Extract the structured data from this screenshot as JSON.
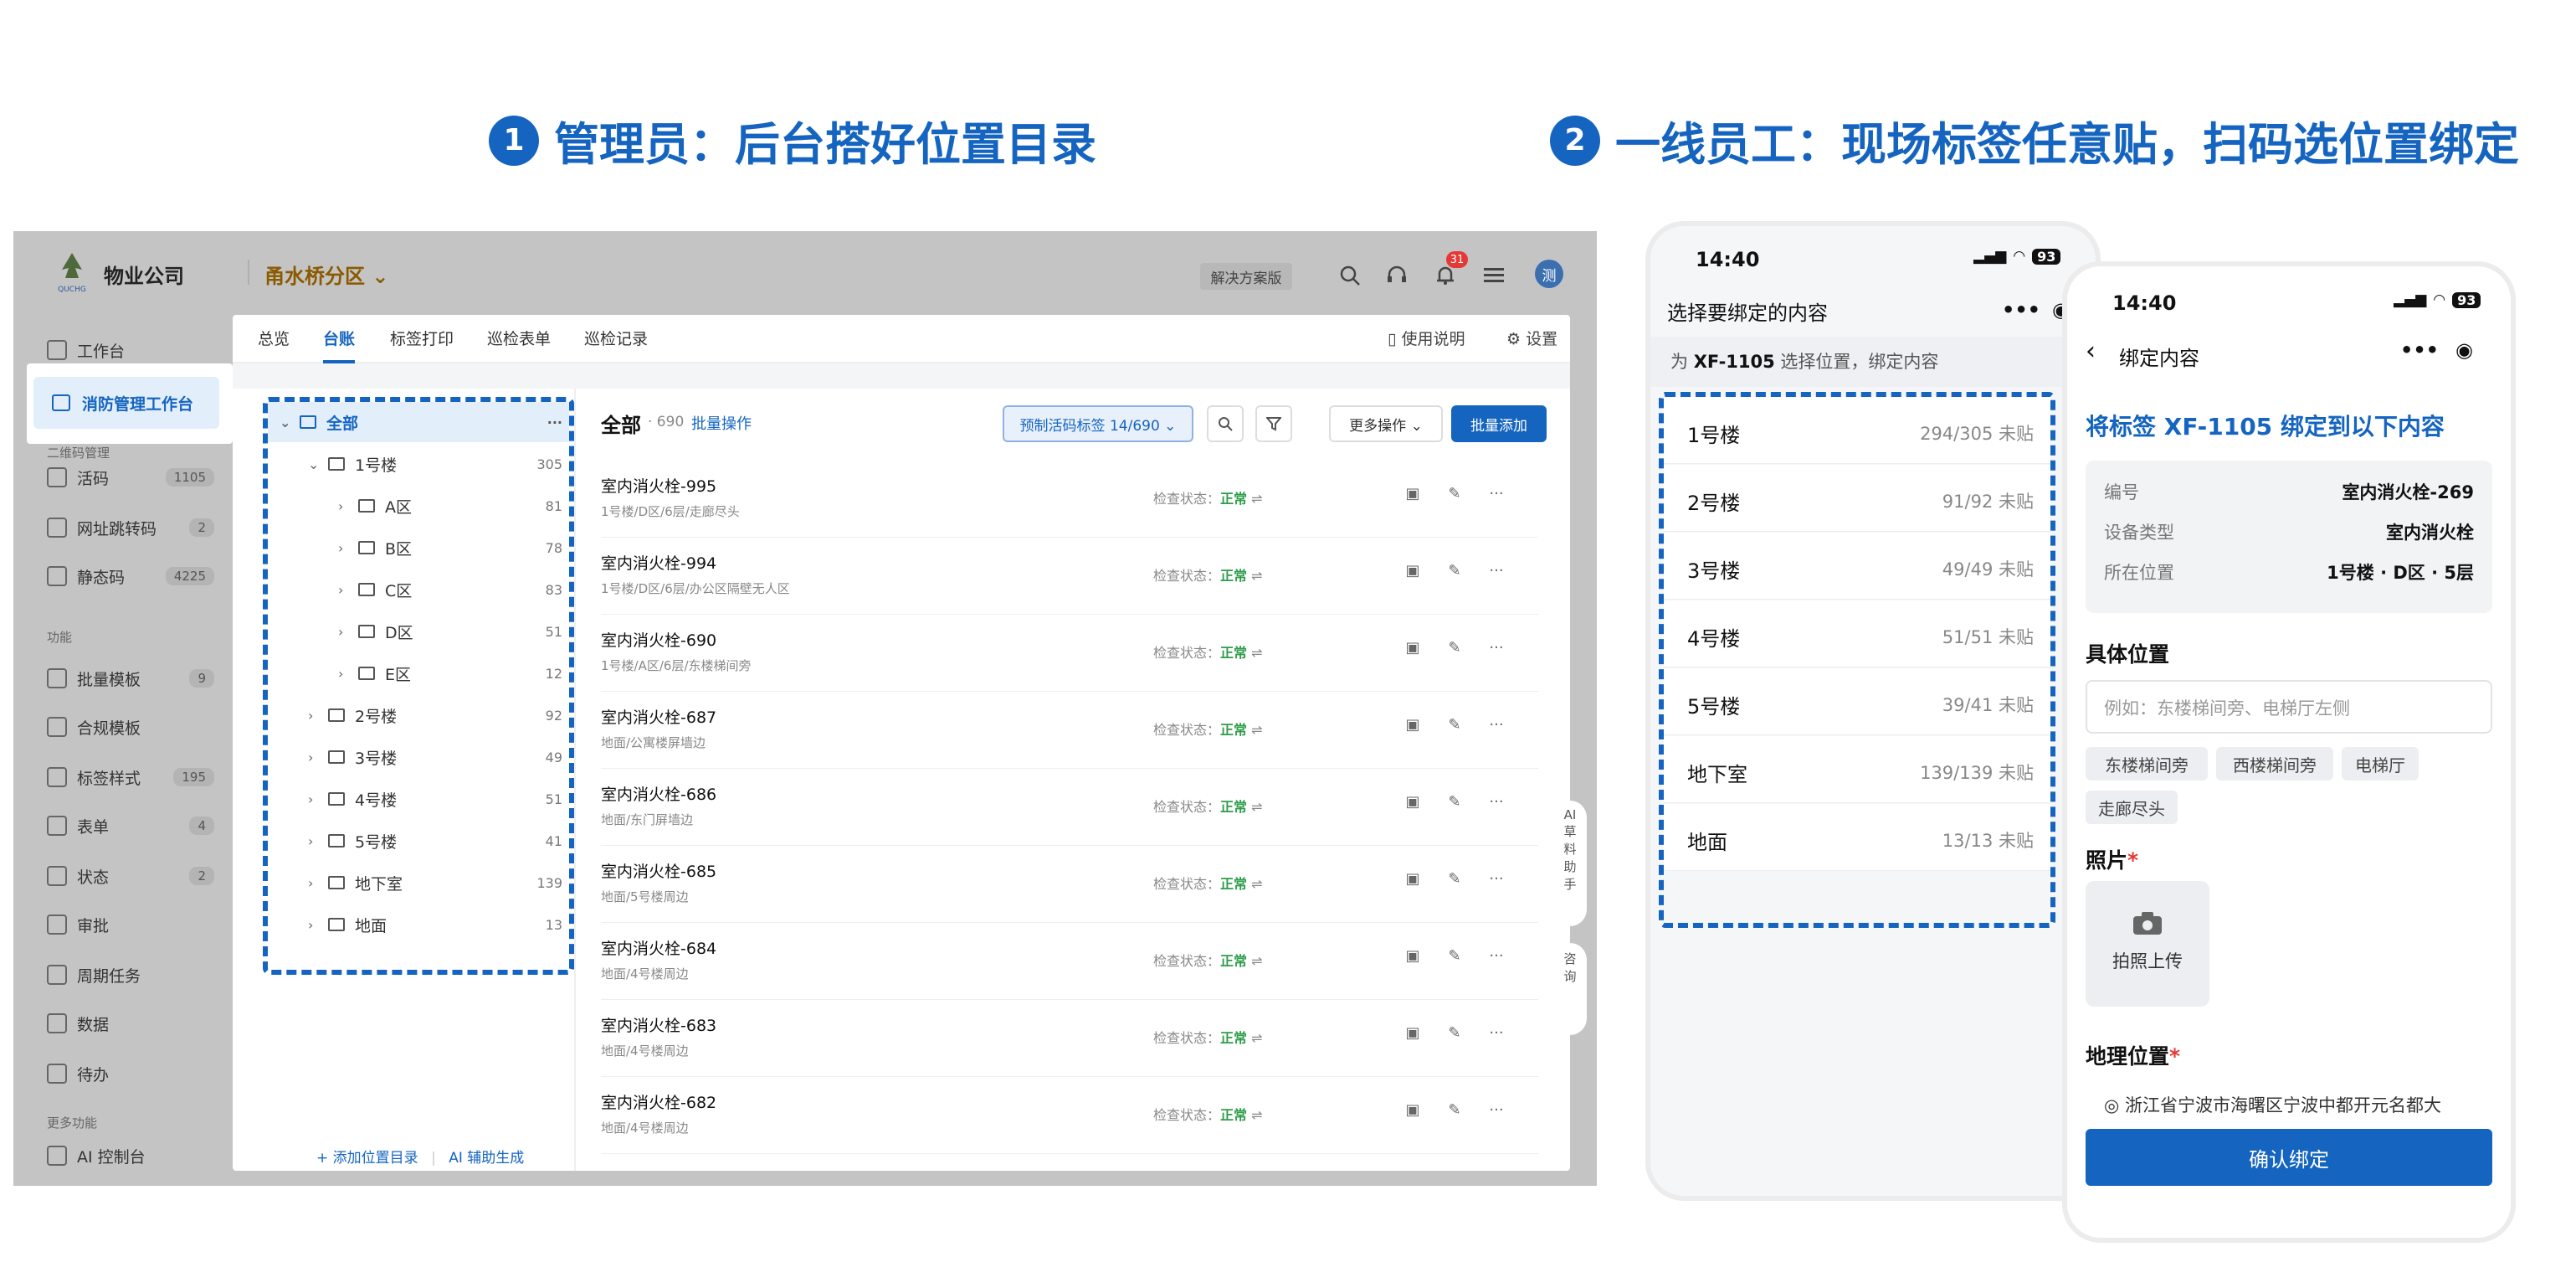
{
  "headings": {
    "step1_num": "1",
    "step1": "管理员：后台搭好位置目录",
    "step2_num": "2",
    "step2": "一线员工：现场标签任意贴，扫码选位置绑定"
  },
  "admin": {
    "org_name": "物业公司",
    "logo_text": "QUCHG",
    "area": "甬水桥分区 ⌄",
    "solution_btn": "解决方案版",
    "notify_badge": "31",
    "avatar": "测",
    "sidebar": {
      "items": [
        {
          "label": "工作台",
          "count": ""
        },
        {
          "label": "消防管理工作台",
          "count": ""
        },
        {
          "label": "活码",
          "count": "1105"
        },
        {
          "label": "网址跳转码",
          "count": "2"
        },
        {
          "label": "静态码",
          "count": "4225"
        },
        {
          "label": "批量模板",
          "count": "9"
        },
        {
          "label": "合规模板",
          "count": ""
        },
        {
          "label": "标签样式",
          "count": "195"
        },
        {
          "label": "表单",
          "count": "4"
        },
        {
          "label": "状态",
          "count": "2"
        },
        {
          "label": "审批",
          "count": ""
        },
        {
          "label": "周期任务",
          "count": ""
        },
        {
          "label": "数据",
          "count": ""
        },
        {
          "label": "待办",
          "count": ""
        },
        {
          "label": "AI 控制台",
          "count": ""
        }
      ],
      "sections": [
        "二维码管理",
        "功能",
        "更多功能"
      ]
    },
    "tabs": [
      "总览",
      "台账",
      "标签打印",
      "巡检表单",
      "巡检记录"
    ],
    "help": "使用说明",
    "settings": "设置",
    "tree": {
      "nodes": [
        {
          "label": "全部",
          "count": "···"
        },
        {
          "label": "1号楼",
          "count": "305"
        },
        {
          "label": "A区",
          "count": "81"
        },
        {
          "label": "B区",
          "count": "78"
        },
        {
          "label": "C区",
          "count": "83"
        },
        {
          "label": "D区",
          "count": "51"
        },
        {
          "label": "E区",
          "count": "12"
        },
        {
          "label": "2号楼",
          "count": "92"
        },
        {
          "label": "3号楼",
          "count": "49"
        },
        {
          "label": "4号楼",
          "count": "51"
        },
        {
          "label": "5号楼",
          "count": "41"
        },
        {
          "label": "地下室",
          "count": "139"
        },
        {
          "label": "地面",
          "count": "13"
        }
      ],
      "add_dir": "+ 添加位置目录",
      "ai_gen": "AI 辅助生成"
    },
    "list": {
      "title": "全部",
      "count": "· 690",
      "batch": "批量操作",
      "tag_btn": "预制活码标签 14/690 ⌄",
      "more_btn": "更多操作 ⌄",
      "add_btn": "批量添加",
      "status_label": "检查状态：",
      "status_value": "正常",
      "rows": [
        {
          "name": "室内消火栓-995",
          "path": "1号楼/D区/6层/走廊尽头"
        },
        {
          "name": "室内消火栓-994",
          "path": "1号楼/D区/6层/办公区隔壁无人区"
        },
        {
          "name": "室内消火栓-690",
          "path": "1号楼/A区/6层/东楼梯间旁"
        },
        {
          "name": "室内消火栓-687",
          "path": "地面/公寓楼屏墙边"
        },
        {
          "name": "室内消火栓-686",
          "path": "地面/东门屏墙边"
        },
        {
          "name": "室内消火栓-685",
          "path": "地面/5号楼周边"
        },
        {
          "name": "室内消火栓-684",
          "path": "地面/4号楼周边"
        },
        {
          "name": "室内消火栓-683",
          "path": "地面/4号楼周边"
        },
        {
          "name": "室内消火栓-682",
          "path": "地面/4号楼周边"
        }
      ]
    },
    "float_ai": "AI\n草\n料\n助\n手",
    "float_consult": "咨\n询"
  },
  "phone1": {
    "time": "14:40",
    "battery": "93",
    "title": "选择要绑定的内容",
    "subtitle_pre": "为 ",
    "subtitle_tag": "XF-1105",
    "subtitle_post": " 选择位置，绑定内容",
    "items": [
      {
        "name": "1号楼",
        "count": "294/305 未贴"
      },
      {
        "name": "2号楼",
        "count": "91/92 未贴"
      },
      {
        "name": "3号楼",
        "count": "49/49 未贴"
      },
      {
        "name": "4号楼",
        "count": "51/51 未贴"
      },
      {
        "name": "5号楼",
        "count": "39/41 未贴"
      },
      {
        "name": "地下室",
        "count": "139/139 未贴"
      },
      {
        "name": "地面",
        "count": "13/13 未贴"
      }
    ]
  },
  "phone2": {
    "time": "14:40",
    "battery": "93",
    "title": "绑定内容",
    "bind_title": "将标签 XF-1105 绑定到以下内容",
    "info": [
      {
        "k": "编号",
        "v": "室内消火栓-269"
      },
      {
        "k": "设备类型",
        "v": "室内消火栓"
      },
      {
        "k": "所在位置",
        "v": "1号楼 · D区 · 5层"
      }
    ],
    "loc_label": "具体位置",
    "loc_placeholder": "例如：东楼梯间旁、电梯厅左侧",
    "chips": [
      "东楼梯间旁",
      "西楼梯间旁",
      "电梯厅",
      "走廊尽头"
    ],
    "photo_label": "照片",
    "photo_btn": "拍照上传",
    "geo_label": "地理位置",
    "geo_value": "浙江省宁波市海曙区宁波中都开元名都大",
    "confirm": "确认绑定",
    "required": "*"
  },
  "colors": {
    "accent": "#1565c0",
    "ok": "#2e9d4a",
    "badge": "#e53935"
  }
}
